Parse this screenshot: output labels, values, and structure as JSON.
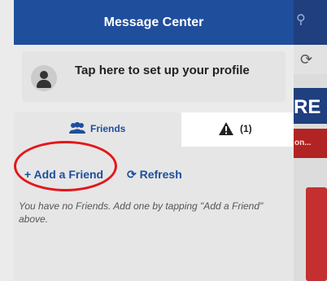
{
  "background_app": {
    "banner_text": "RE",
    "red_strip_text": "on...",
    "search_icon": "search-icon",
    "refresh_icon": "refresh-icon"
  },
  "panel": {
    "title": "Message Center",
    "profile_prompt": "Tap here to set up your profile",
    "tabs": {
      "friends_label": "Friends",
      "alerts_label": "(1)"
    },
    "actions": {
      "add_friend": "+ Add a Friend",
      "refresh": "Refresh"
    },
    "empty_message": "You have no Friends. Add one by tapping \"Add a Friend\" above."
  },
  "colors": {
    "header_blue": "#1f4e9d",
    "annotation_red": "#e3171c",
    "panel_bg": "#ebebeb"
  }
}
